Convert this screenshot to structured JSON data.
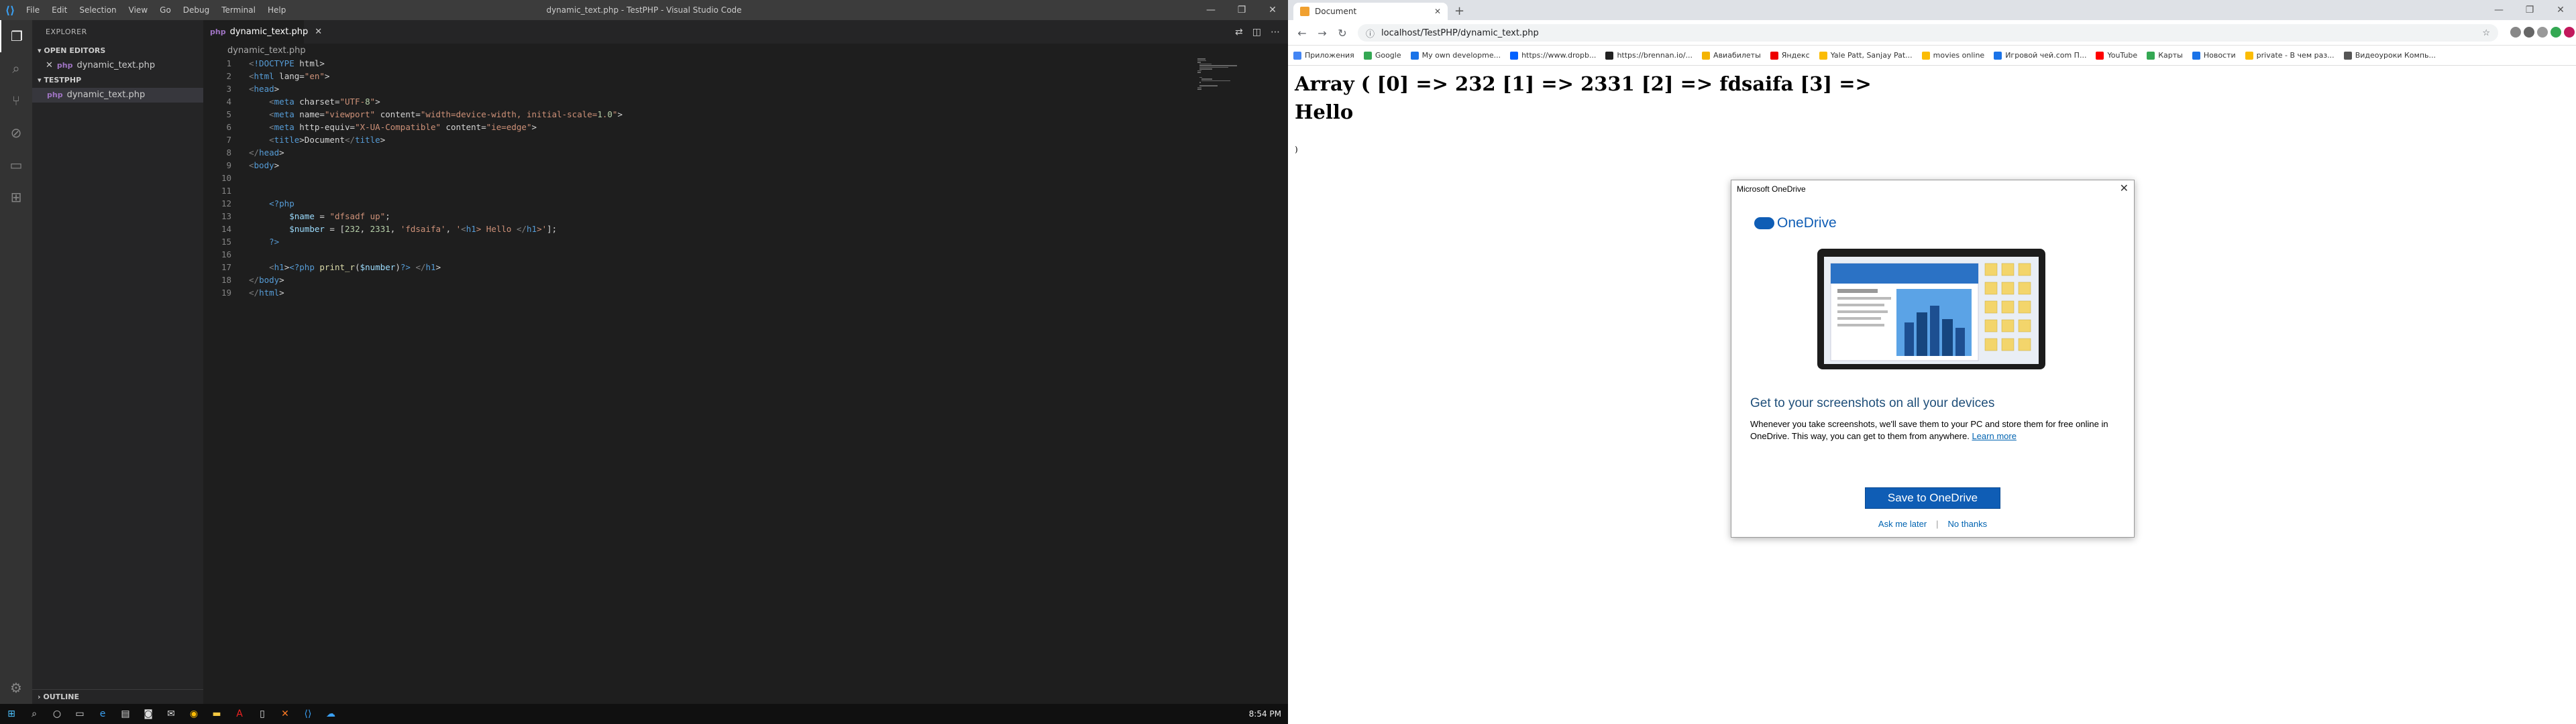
{
  "vscode": {
    "window_title": "dynamic_text.php - TestPHP - Visual Studio Code",
    "menu": [
      "File",
      "Edit",
      "Selection",
      "View",
      "Go",
      "Debug",
      "Terminal",
      "Help"
    ],
    "explorer_header": "EXPLORER",
    "open_editors": "OPEN EDITORS",
    "open_file": "dynamic_text.php",
    "project": "TESTPHP",
    "project_file": "dynamic_text.php",
    "outline": "OUTLINE",
    "tab_label": "dynamic_text.php",
    "breadcrumb": "dynamic_text.php",
    "lines": [
      "<!DOCTYPE html>",
      "<html lang=\"en\">",
      "<head>",
      "    <meta charset=\"UTF-8\">",
      "    <meta name=\"viewport\" content=\"width=device-width, initial-scale=1.0\">",
      "    <meta http-equiv=\"X-UA-Compatible\" content=\"ie=edge\">",
      "    <title>Document</title>",
      "</head>",
      "<body>",
      "",
      "",
      "    <?php",
      "        $name = \"dfsadf up\";",
      "        $number = [232, 2331, 'fdsaifa', '<h1> Hello </h1>'];",
      "    ?>",
      "",
      "    <h1><?php print_r($number)?> </h1>",
      "</body>",
      "</html>"
    ]
  },
  "taskbar": {
    "clock": "8:54 PM"
  },
  "chrome": {
    "tab_title": "Document",
    "url": "localhost/TestPHP/dynamic_text.php",
    "bookmarks": [
      {
        "label": "Приложения",
        "color": "#4285f4"
      },
      {
        "label": "Google",
        "color": "#34a853"
      },
      {
        "label": "My own developme...",
        "color": "#1a73e8"
      },
      {
        "label": "https://www.dropb...",
        "color": "#0061ff"
      },
      {
        "label": "https://brennan.io/...",
        "color": "#222"
      },
      {
        "label": "Авиабилеты",
        "color": "#f4b400"
      },
      {
        "label": "Яндекс",
        "color": "#e00"
      },
      {
        "label": "Yale Patt, Sanjay Pat...",
        "color": "#fbbc04"
      },
      {
        "label": "movies online",
        "color": "#fbbc04"
      },
      {
        "label": "Игровой чей.com П...",
        "color": "#1a73e8"
      },
      {
        "label": "YouTube",
        "color": "#ff0000"
      },
      {
        "label": "Карты",
        "color": "#34a853"
      },
      {
        "label": "Новости",
        "color": "#1a73e8"
      },
      {
        "label": "private - В чем раз...",
        "color": "#fbbc04"
      },
      {
        "label": "Видеоуроки Компь...",
        "color": "#555"
      }
    ],
    "page": {
      "h1_array": "Array ( [0] => 232 [1] => 2331 [2] => fdsaifa [3] =>",
      "h1_hello": "Hello",
      "paren": ")"
    }
  },
  "onedrive_dialog": {
    "title": "Microsoft OneDrive",
    "logo_text": "OneDrive",
    "heading": "Get to your screenshots on all your devices",
    "body": "Whenever you take screenshots, we'll save them to your PC and store them for free online in OneDrive. This way, you can get to them from anywhere.",
    "learn_more": "Learn more",
    "save_button": "Save to OneDrive",
    "ask_later": "Ask me later",
    "no_thanks": "No thanks"
  }
}
